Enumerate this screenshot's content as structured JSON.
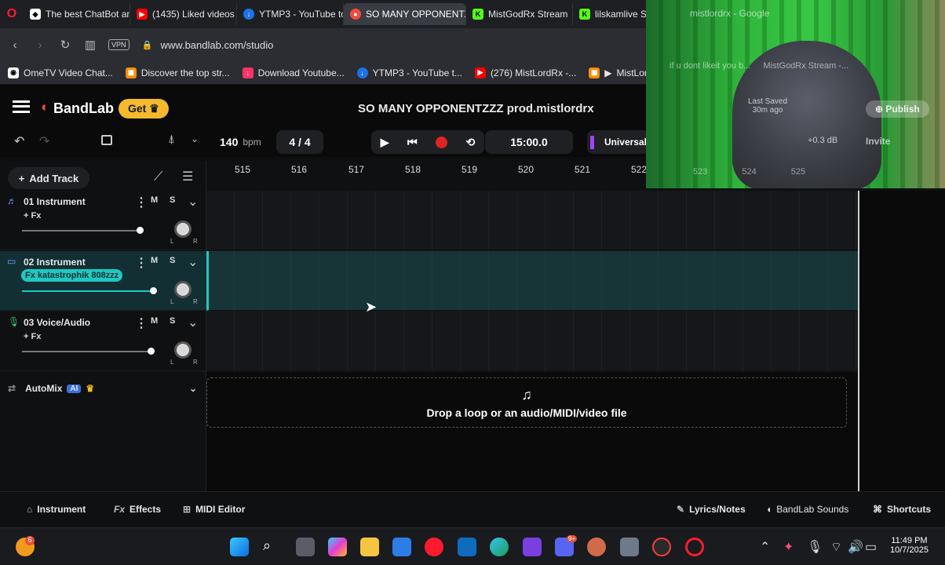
{
  "browser": {
    "tabs": [
      {
        "label": "The best ChatBot and",
        "icon": "chatbot-favicon",
        "color": "#ffffff"
      },
      {
        "label": "(1435) Liked videos -",
        "icon": "youtube-favicon",
        "color": "#ff0000"
      },
      {
        "label": "YTMP3 - YouTube to",
        "icon": "ytmp3-favicon",
        "color": "#1a73e8"
      },
      {
        "label": "SO MANY OPPONENTZZZ",
        "icon": "bandlab-favicon",
        "color": "#f24b3c"
      },
      {
        "label": "MistGodRx Stream",
        "icon": "kick-favicon",
        "color": "#53fc18"
      },
      {
        "label": "lilskamlive Stream",
        "icon": "kick-favicon",
        "color": "#53fc18"
      },
      {
        "label": "mistlordrx - Google",
        "icon": "google-favicon",
        "color": "#aaaaaa"
      }
    ],
    "url": "www.bandlab.com/studio",
    "vpn_label": "VPN",
    "bookmarks": [
      {
        "label": "OmeTV Video Chat...",
        "icon": "ometv-favicon",
        "color": "#ffffff"
      },
      {
        "label": "Discover the top str...",
        "icon": "discover-favicon",
        "color": "#ff8c00"
      },
      {
        "label": "Download Youtube...",
        "icon": "download-favicon",
        "color": "#ff3366"
      },
      {
        "label": "YTMP3 - YouTube t...",
        "icon": "ytmp3-favicon",
        "color": "#1a73e8"
      },
      {
        "label": "(276) MistLordRx -...",
        "icon": "youtube-favicon",
        "color": "#ff0000"
      },
      {
        "label": "MistLordRx ide...",
        "icon": "discover-favicon",
        "color": "#ff8c00"
      },
      {
        "label": "if u dont likeit you b...",
        "icon": "bookmark-favicon",
        "color": "#999999"
      },
      {
        "label": "MistGodRx Stream -...",
        "icon": "kick-favicon",
        "color": "#53fc18"
      }
    ]
  },
  "app": {
    "brand": "BandLab",
    "get_label": "Get",
    "project_title": "SO MANY OPPONENTZZZ prod.mistlordrx",
    "last_saved": "Last Saved",
    "saved_ago": "30m ago",
    "publish_label": "Publish",
    "tempo": "140",
    "tempo_unit": "bpm",
    "time_sig": "4 / 4",
    "time_display": "15:00.0",
    "universal_label": "Universal",
    "master_gain": "+0.3 dB",
    "invite_label": "Invite",
    "add_track_label": "Add Track",
    "ruler": [
      "515",
      "516",
      "517",
      "518",
      "519",
      "520",
      "521",
      "522",
      "523",
      "524",
      "525"
    ],
    "tracks": [
      {
        "name": "01  Instrument",
        "fx": "+ Fx",
        "volume": 0.99,
        "selected": false,
        "icon": "instrument-icon"
      },
      {
        "name": "02  Instrument",
        "fx": "Fx katastrophik 808zzz",
        "volume": 1.0,
        "selected": true,
        "icon": "instrument-icon"
      },
      {
        "name": "03  Voice/Audio",
        "fx": "+ Fx",
        "volume": 1.0,
        "selected": false,
        "icon": "mic-icon"
      }
    ],
    "mute_label": "M",
    "solo_label": "S",
    "pan_left": "L",
    "pan_right": "R",
    "automix_label": "AutoMix",
    "ai_badge": "AI",
    "drop_text": "Drop a loop or an audio/MIDI/video file",
    "bottom": {
      "instrument": "Instrument",
      "effects": "Effects",
      "midi_editor": "MIDI Editor",
      "lyrics": "Lyrics/Notes",
      "sounds": "BandLab Sounds",
      "shortcuts": "Shortcuts"
    }
  },
  "taskbar": {
    "time": "11:49 PM",
    "date": "10/7/2025",
    "notification_count": "6",
    "discord_badge": "9+"
  }
}
